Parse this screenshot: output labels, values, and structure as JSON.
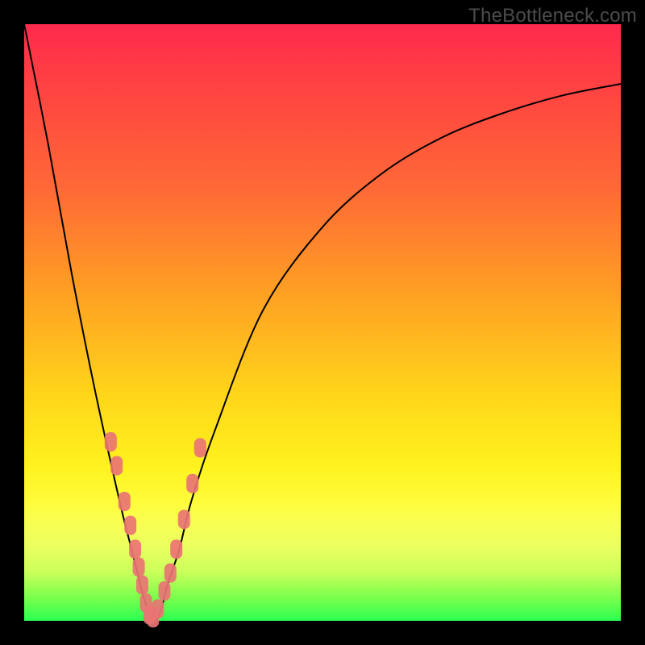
{
  "watermark": "TheBottleneck.com",
  "chart_data": {
    "type": "line",
    "title": "",
    "xlabel": "",
    "ylabel": "",
    "xlim": [
      0,
      100
    ],
    "ylim": [
      0,
      100
    ],
    "series": [
      {
        "name": "bottleneck-curve",
        "x": [
          0,
          4,
          8,
          12,
          16,
          18,
          19,
          20,
          21,
          22,
          23,
          24,
          26,
          28,
          32,
          40,
          50,
          60,
          70,
          80,
          90,
          100
        ],
        "y": [
          100,
          80,
          58,
          38,
          20,
          12,
          8,
          4,
          1,
          0,
          2,
          6,
          12,
          20,
          32,
          52,
          66,
          75,
          81,
          85,
          88,
          90
        ]
      }
    ],
    "markers": {
      "name": "highlighted-points",
      "x": [
        14.5,
        15.5,
        16.8,
        17.8,
        18.6,
        19.2,
        19.8,
        20.4,
        21.0,
        21.6,
        22.4,
        23.5,
        24.5,
        25.5,
        26.8,
        28.2,
        29.5
      ],
      "y": [
        30,
        26,
        20,
        16,
        12,
        9,
        6,
        3,
        1,
        0.5,
        2,
        5,
        8,
        12,
        17,
        23,
        29
      ]
    },
    "background": {
      "gradient_stops": [
        {
          "pos": 0,
          "color": "#ff2a4d"
        },
        {
          "pos": 28,
          "color": "#ff6a36"
        },
        {
          "pos": 62,
          "color": "#ffd51a"
        },
        {
          "pos": 84,
          "color": "#f7ff55"
        },
        {
          "pos": 100,
          "color": "#2bff52"
        }
      ]
    }
  }
}
